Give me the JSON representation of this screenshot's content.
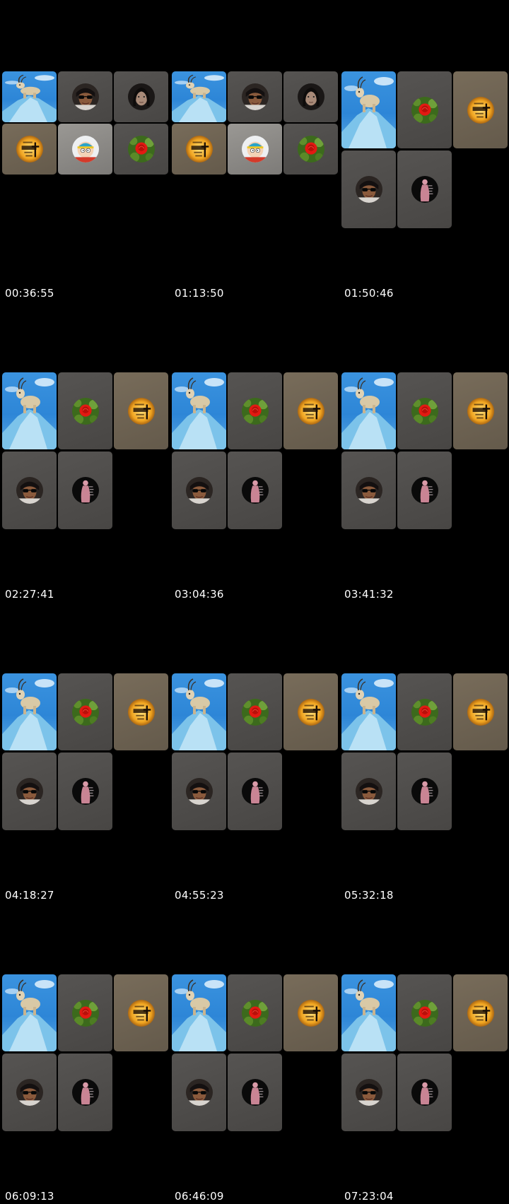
{
  "frames": [
    {
      "timestamp": "00:36:55",
      "layout": "a"
    },
    {
      "timestamp": "01:13:50",
      "layout": "a"
    },
    {
      "timestamp": "01:50:46",
      "layout": "b"
    },
    {
      "timestamp": "02:27:41",
      "layout": "b"
    },
    {
      "timestamp": "03:04:36",
      "layout": "b"
    },
    {
      "timestamp": "03:41:32",
      "layout": "b"
    },
    {
      "timestamp": "04:18:27",
      "layout": "b"
    },
    {
      "timestamp": "04:55:23",
      "layout": "b"
    },
    {
      "timestamp": "05:32:18",
      "layout": "b"
    },
    {
      "timestamp": "06:09:13",
      "layout": "b"
    },
    {
      "timestamp": "06:46:09",
      "layout": "b"
    },
    {
      "timestamp": "07:23:04",
      "layout": "b"
    }
  ],
  "layouts": {
    "a": [
      "goat",
      "sunglasses",
      "dark-hair",
      "cross",
      "cartman",
      "rose"
    ],
    "b": [
      "goat",
      "rose",
      "cross",
      "sunglasses",
      "pink-figure"
    ]
  },
  "colors": {
    "background": "#000000",
    "tile": "#4f4d4b",
    "sky": "#3b93df"
  }
}
